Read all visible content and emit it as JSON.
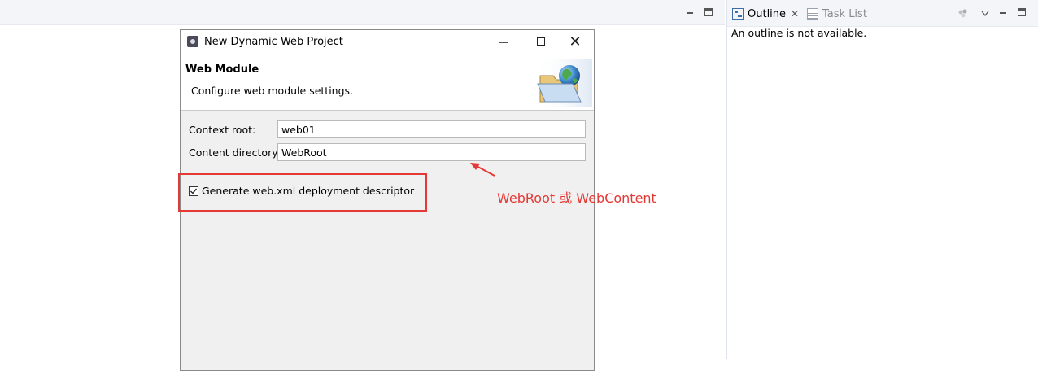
{
  "dialog": {
    "title": "New Dynamic Web Project",
    "header_title": "Web Module",
    "header_desc": "Configure web module settings.",
    "context_root_label": "Context root:",
    "context_root_value": "web01",
    "content_dir_label": "Content directory:",
    "content_dir_value": "WebRoot",
    "checkbox_label": "Generate web.xml deployment descriptor",
    "checkbox_checked": true,
    "close_glyph": "✕"
  },
  "outline": {
    "tab_outline": "Outline",
    "tab_task": "Task List",
    "close_glyph": "✕",
    "message": "An outline is not available."
  },
  "annotation": {
    "text": "WebRoot 或 WebContent",
    "color": "#e53935"
  },
  "icons": [
    "outline-icon",
    "task-list-icon",
    "wizard-folder-globe-icon",
    "eclipse-dialog-icon"
  ]
}
